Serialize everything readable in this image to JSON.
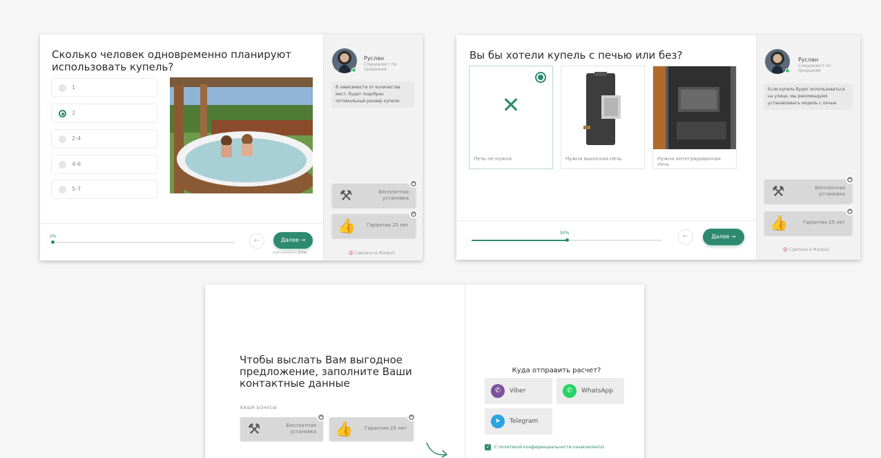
{
  "colors": {
    "accent": "#2d8a6e",
    "sidebar": "#f2f2f2",
    "background": "#f6f6f6"
  },
  "manager": {
    "name": "Руслан",
    "role": "Специалист по продажам"
  },
  "bonuses": [
    {
      "label": "Бесплатная установка",
      "icon": "tools-icon",
      "locked": true
    },
    {
      "label": "Гарантия 25 лет",
      "icon": "thumbs-up-icon",
      "locked": true
    }
  ],
  "branding": {
    "made_in": "Сделано в Marquiz"
  },
  "quiz1": {
    "title": "Сколько человек одновременно планируют использовать купель?",
    "options": [
      {
        "label": "1",
        "selected": false
      },
      {
        "label": "2",
        "selected": true
      },
      {
        "label": "2-4",
        "selected": false
      },
      {
        "label": "4-6",
        "selected": false
      },
      {
        "label": "5-7",
        "selected": false
      }
    ],
    "bubble": "В зависимости от количества мест, будет подобран оптимальный размер купели",
    "progress_label": "0%",
    "progress": 0,
    "next_label": "Далее →",
    "back_label": "←",
    "hint_prefix": "или нажмите",
    "hint_key": "Enter"
  },
  "quiz2": {
    "title": "Вы бы хотели купель с печью или без?",
    "options": [
      {
        "label": "Печь не нужна",
        "selected": true,
        "image": "none"
      },
      {
        "label": "Нужна выносная печь",
        "selected": false,
        "image": "external-stove"
      },
      {
        "label": "Нужна интегрированная печь",
        "selected": false,
        "image": "integrated-stove"
      }
    ],
    "bubble": "Если купель будет использоваться на улице, мы рекомендуем устанавливать модель с печью",
    "progress_label": "50%",
    "progress": 50,
    "next_label": "Далее →",
    "back_label": "←"
  },
  "contact": {
    "title": "Чтобы выслать Вам выгодное предложение, заполните Ваши контактные данные",
    "bonuses_label": "ВАШИ БОНУСЫ",
    "send_title": "Куда отправить расчет?",
    "messengers": [
      {
        "label": "Viber",
        "color": "#7b519d"
      },
      {
        "label": "WhatsApp",
        "color": "#25d366"
      },
      {
        "label": "Telegram",
        "color": "#2aa3e0"
      }
    ],
    "policy": "С политикой конфиденциальности ознакомлен(а)"
  }
}
